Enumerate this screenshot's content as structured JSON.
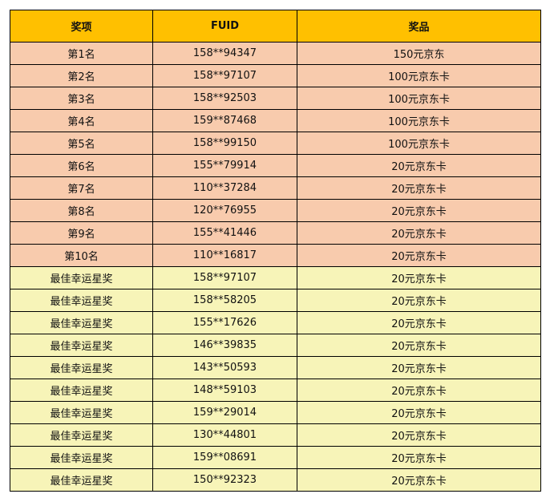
{
  "headers": {
    "award": "奖项",
    "fuid": "FUID",
    "prize": "奖品"
  },
  "colors": {
    "header": "#ffc000",
    "rank_rows": "#f8cbad",
    "lucky_rows": "#f7f4b8",
    "border": "#000000"
  },
  "rows": [
    {
      "award": "第1名",
      "fuid": "158**94347",
      "prize": "150元京东",
      "group": "rank"
    },
    {
      "award": "第2名",
      "fuid": "158**97107",
      "prize": "100元京东卡",
      "group": "rank"
    },
    {
      "award": "第3名",
      "fuid": "158**92503",
      "prize": "100元京东卡",
      "group": "rank"
    },
    {
      "award": "第4名",
      "fuid": "159**87468",
      "prize": "100元京东卡",
      "group": "rank"
    },
    {
      "award": "第5名",
      "fuid": "158**99150",
      "prize": "100元京东卡",
      "group": "rank"
    },
    {
      "award": "第6名",
      "fuid": "155**79914",
      "prize": "20元京东卡",
      "group": "rank"
    },
    {
      "award": "第7名",
      "fuid": "110**37284",
      "prize": "20元京东卡",
      "group": "rank"
    },
    {
      "award": "第8名",
      "fuid": "120**76955",
      "prize": "20元京东卡",
      "group": "rank"
    },
    {
      "award": "第9名",
      "fuid": "155**41446",
      "prize": "20元京东卡",
      "group": "rank"
    },
    {
      "award": "第10名",
      "fuid": "110**16817",
      "prize": "20元京东卡",
      "group": "rank"
    },
    {
      "award": "最佳幸运星奖",
      "fuid": "158**97107",
      "prize": "20元京东卡",
      "group": "lucky"
    },
    {
      "award": "最佳幸运星奖",
      "fuid": "158**58205",
      "prize": "20元京东卡",
      "group": "lucky"
    },
    {
      "award": "最佳幸运星奖",
      "fuid": "155**17626",
      "prize": "20元京东卡",
      "group": "lucky"
    },
    {
      "award": "最佳幸运星奖",
      "fuid": "146**39835",
      "prize": "20元京东卡",
      "group": "lucky"
    },
    {
      "award": "最佳幸运星奖",
      "fuid": "143**50593",
      "prize": "20元京东卡",
      "group": "lucky"
    },
    {
      "award": "最佳幸运星奖",
      "fuid": "148**59103",
      "prize": "20元京东卡",
      "group": "lucky"
    },
    {
      "award": "最佳幸运星奖",
      "fuid": "159**29014",
      "prize": "20元京东卡",
      "group": "lucky"
    },
    {
      "award": "最佳幸运星奖",
      "fuid": "130**44801",
      "prize": "20元京东卡",
      "group": "lucky"
    },
    {
      "award": "最佳幸运星奖",
      "fuid": "159**08691",
      "prize": "20元京东卡",
      "group": "lucky"
    },
    {
      "award": "最佳幸运星奖",
      "fuid": "150**92323",
      "prize": "20元京东卡",
      "group": "lucky"
    }
  ]
}
